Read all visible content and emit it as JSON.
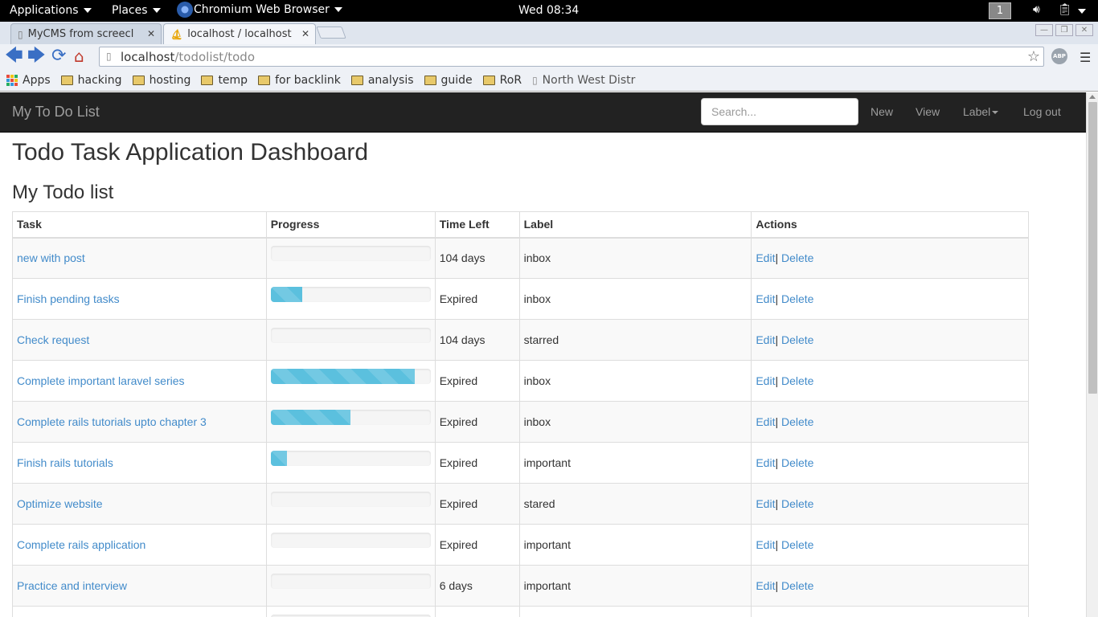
{
  "gnome": {
    "applications": "Applications",
    "places": "Places",
    "app_name": "Chromium Web Browser",
    "clock": "Wed 08:34",
    "workspace": "1"
  },
  "browser": {
    "tabs": [
      {
        "title": "MyCMS from screecl"
      },
      {
        "title": "localhost / localhost"
      }
    ],
    "url_host": "localhost",
    "url_path": "/todolist/todo",
    "abp": "ABP",
    "bookmarks": [
      {
        "label": "Apps",
        "icon": "apps-grid-icon"
      },
      {
        "label": "hacking",
        "icon": "folder-icon"
      },
      {
        "label": "hosting",
        "icon": "folder-icon"
      },
      {
        "label": "temp",
        "icon": "folder-icon"
      },
      {
        "label": "for backlink",
        "icon": "folder-icon"
      },
      {
        "label": "analysis",
        "icon": "folder-icon"
      },
      {
        "label": "guide",
        "icon": "folder-icon"
      },
      {
        "label": "RoR",
        "icon": "folder-icon"
      },
      {
        "label": "North West Distr",
        "icon": "page-icon"
      }
    ]
  },
  "navbar": {
    "brand": "My To Do List",
    "search_placeholder": "Search...",
    "links": {
      "new": "New",
      "view": "View",
      "label": "Label",
      "logout": "Log out"
    }
  },
  "page": {
    "title": "Todo Task Application Dashboard",
    "subtitle": "My Todo list"
  },
  "table": {
    "headers": {
      "task": "Task",
      "progress": "Progress",
      "time_left": "Time Left",
      "label": "Label",
      "actions": "Actions"
    },
    "edit_label": "Edit",
    "separator": "|",
    "delete_label": "Delete",
    "rows": [
      {
        "task": "new with post",
        "progress": 0,
        "time_left": "104 days",
        "label": "inbox"
      },
      {
        "task": "Finish pending tasks",
        "progress": 20,
        "time_left": "Expired",
        "label": "inbox"
      },
      {
        "task": "Check request",
        "progress": 0,
        "time_left": "104 days",
        "label": "starred"
      },
      {
        "task": "Complete important laravel series",
        "progress": 90,
        "time_left": "Expired",
        "label": "inbox"
      },
      {
        "task": "Complete rails tutorials upto chapter 3",
        "progress": 50,
        "time_left": "Expired",
        "label": "inbox"
      },
      {
        "task": "Finish rails tutorials",
        "progress": 10,
        "time_left": "Expired",
        "label": "important"
      },
      {
        "task": "Optimize website",
        "progress": 0,
        "time_left": "Expired",
        "label": "stared"
      },
      {
        "task": "Complete rails application",
        "progress": 0,
        "time_left": "Expired",
        "label": "important"
      },
      {
        "task": "Practice and interview",
        "progress": 0,
        "time_left": "6 days",
        "label": "important"
      },
      {
        "task": "",
        "progress": 0,
        "time_left": "",
        "label": ""
      }
    ]
  },
  "colors": {
    "link": "#428bca",
    "progress": "#5bc0de",
    "navbar": "#222222"
  }
}
